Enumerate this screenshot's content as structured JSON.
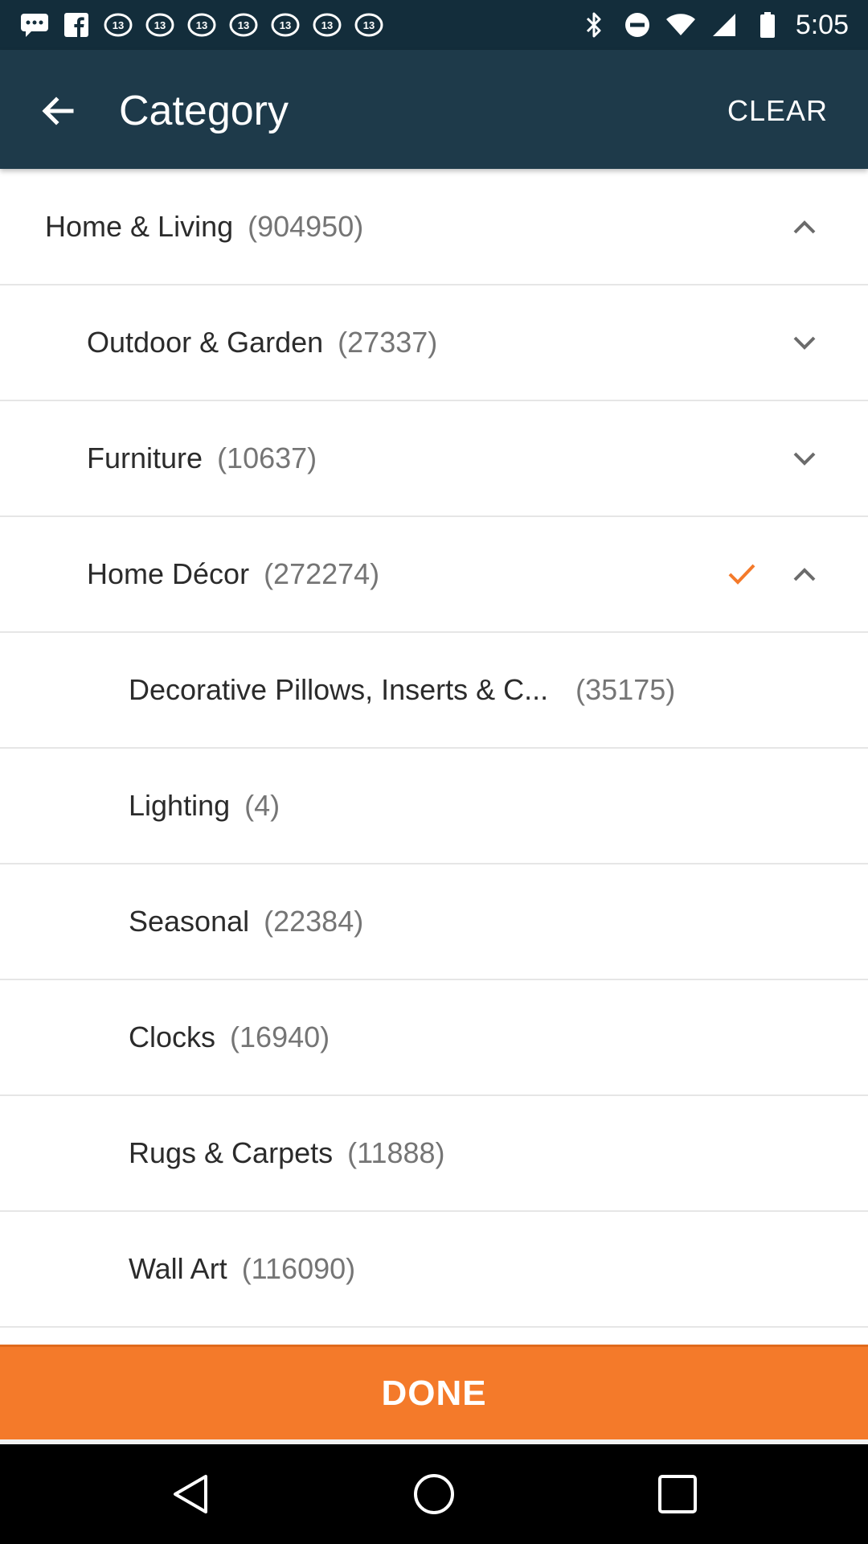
{
  "status_bar": {
    "time": "5:05",
    "badge_text": "abc13",
    "icons": [
      "message-icon",
      "facebook-icon",
      "abc13-icon",
      "abc13-icon",
      "abc13-icon",
      "abc13-icon",
      "abc13-icon",
      "abc13-icon",
      "abc13-icon",
      "bluetooth-icon",
      "do-not-disturb-icon",
      "wifi-icon",
      "signal-icon",
      "battery-icon"
    ]
  },
  "appbar": {
    "title": "Category",
    "clear_label": "CLEAR",
    "back_icon": "arrow-left-icon"
  },
  "colors": {
    "status_bar_bg": "#132d3b",
    "appbar_bg": "#1e3a4a",
    "accent_orange": "#f47a2a"
  },
  "categories": [
    {
      "name": "Home & Living",
      "count": "(904950)",
      "level": 0,
      "chevron": "up",
      "checked": false
    },
    {
      "name": "Outdoor & Garden",
      "count": "(27337)",
      "level": 1,
      "chevron": "down",
      "checked": false
    },
    {
      "name": "Furniture",
      "count": "(10637)",
      "level": 1,
      "chevron": "down",
      "checked": false
    },
    {
      "name": "Home Décor",
      "count": "(272274)",
      "level": 1,
      "chevron": "up",
      "checked": true
    },
    {
      "name": "Decorative Pillows, Inserts & C...",
      "count": "(35175)",
      "level": 2,
      "chevron": "",
      "checked": false
    },
    {
      "name": "Lighting",
      "count": "(4)",
      "level": 2,
      "chevron": "",
      "checked": false
    },
    {
      "name": "Seasonal",
      "count": "(22384)",
      "level": 2,
      "chevron": "",
      "checked": false
    },
    {
      "name": "Clocks",
      "count": "(16940)",
      "level": 2,
      "chevron": "",
      "checked": false
    },
    {
      "name": "Rugs & Carpets",
      "count": "(11888)",
      "level": 2,
      "chevron": "",
      "checked": false
    },
    {
      "name": "Wall Art",
      "count": "(116090)",
      "level": 2,
      "chevron": "",
      "checked": false
    }
  ],
  "done_label": "DONE"
}
